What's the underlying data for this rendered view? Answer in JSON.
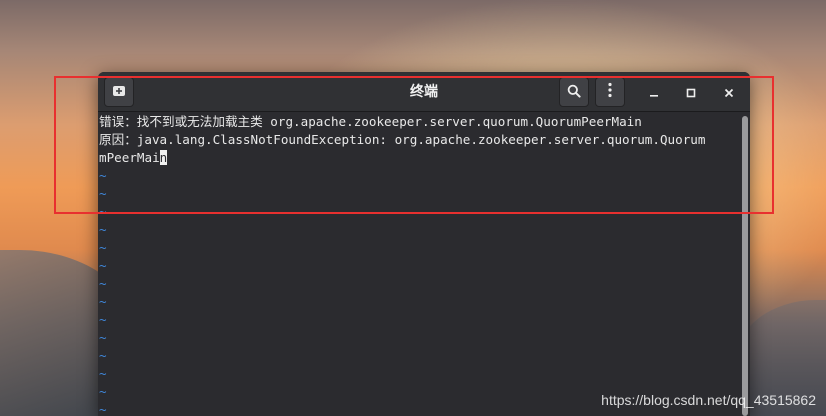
{
  "window": {
    "title": "终端"
  },
  "header_icons": {
    "new_tab": "new-tab-icon",
    "search": "search-icon",
    "menu": "kebab-menu-icon",
    "minimize": "minimize-icon",
    "maximize": "maximize-icon",
    "close": "close-icon"
  },
  "terminal": {
    "line1": "错误：找不到或无法加载主类 org.apache.zookeeper.server.quorum.QuorumPeerMain",
    "line2": "原因：java.lang.ClassNotFoundException: org.apache.zookeeper.server.quorum.Quorum",
    "line3_prefix": "mPeerMai",
    "line3_cursor_char": "n",
    "tilde": "~"
  },
  "colors": {
    "highlight_border": "#e8302f",
    "tilde": "#3f86d9",
    "terminal_bg": "#2b2b2f"
  },
  "watermark": "https://blog.csdn.net/qq_43515862"
}
